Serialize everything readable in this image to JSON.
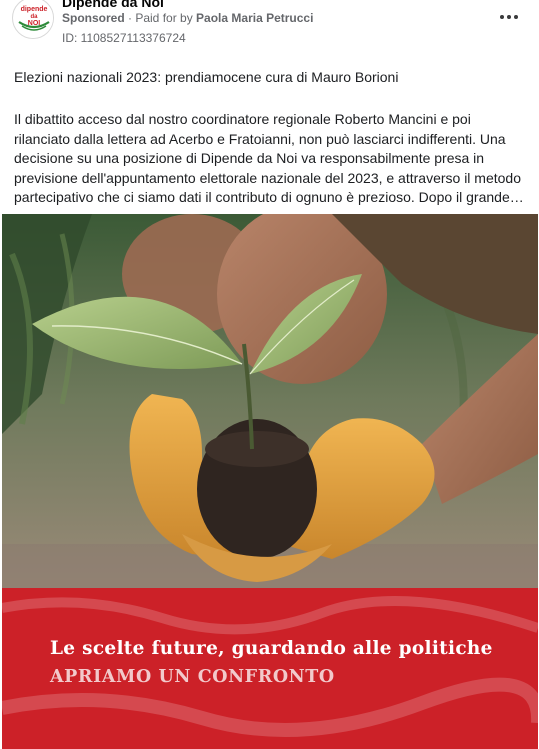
{
  "header": {
    "page_name": "Dipende da Noi",
    "sponsored": "Sponsored",
    "paid_for_prefix": " · Paid for by ",
    "payer": "Paola Maria Petrucci",
    "ad_id": "ID: 1108527113376724",
    "more_icon": "more-horizontal-icon"
  },
  "avatar": {
    "logo_top": "dipende",
    "logo_mid": "da",
    "logo_bottom": "NOI"
  },
  "post": {
    "title": "Elezioni nazionali 2023: prendiamocene cura di Mauro Borioni",
    "body": "Il dibattito acceso dal nostro coordinatore regionale Roberto Mancini e poi rilanciato dalla lettera ad Acerbo e Fratoianni, non può lasciarci indifferenti. Una decisione su una posizione di Dipende da Noi va responsabilmente presa in previsione dell'appuntamento elettorale nazionale del 2023, e attraverso il metodo partecipativo che ci siamo dati il contributo di ognuno è prezioso. Dopo il grande…"
  },
  "creative": {
    "headline": "Le scelte future, guardando alle politiche",
    "subheadline": "APRIAMO UN CONFRONTO",
    "banner_color": "#cc2128",
    "image_subject": "gloved-hands-holding-seedling"
  }
}
